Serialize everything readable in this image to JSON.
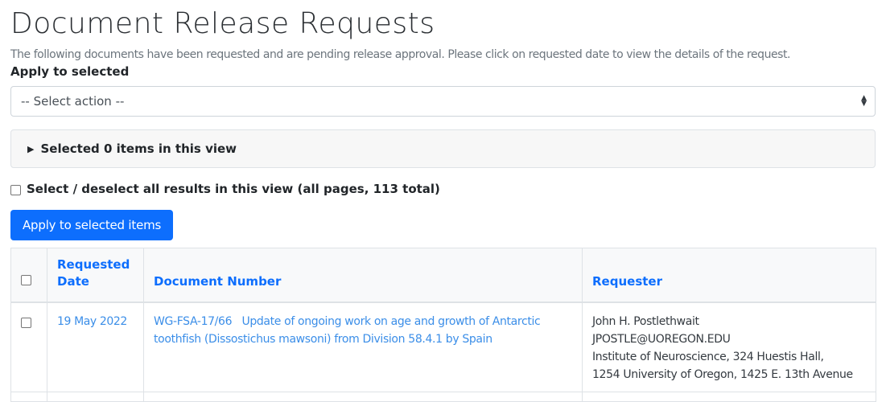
{
  "page": {
    "title": "Document Release Requests",
    "intro": "The following documents have been requested and are pending release approval. Please click on requested date to view the details of the request.",
    "apply_label": "Apply to selected",
    "select_placeholder": "-- Select action --",
    "selected_summary": "Selected 0 items in this view",
    "select_all_label": "Select / deselect all results in this view (all pages, 113 total)",
    "apply_button": "Apply to selected items"
  },
  "table": {
    "headers": [
      "Requested Date",
      "Document Number",
      "Requester"
    ],
    "rows": [
      {
        "date": "19 May 2022",
        "document": "WG-FSA-17/66   Update of ongoing work on age and growth of Antarctic toothfish (Dissostichus mawsoni) from Division 58.4.1 by Spain",
        "requester": {
          "name": "John H. Postlethwait",
          "email": "JPOSTLE@UOREGON.EDU",
          "address1": "Institute of Neuroscience, 324 Huestis Hall,",
          "address2": "1254 University of Oregon, 1425 E. 13th Avenue"
        }
      }
    ]
  },
  "colors": {
    "link": "#0d6efd",
    "button": "#0d6efd",
    "header_bg": "#f8f9fa"
  }
}
